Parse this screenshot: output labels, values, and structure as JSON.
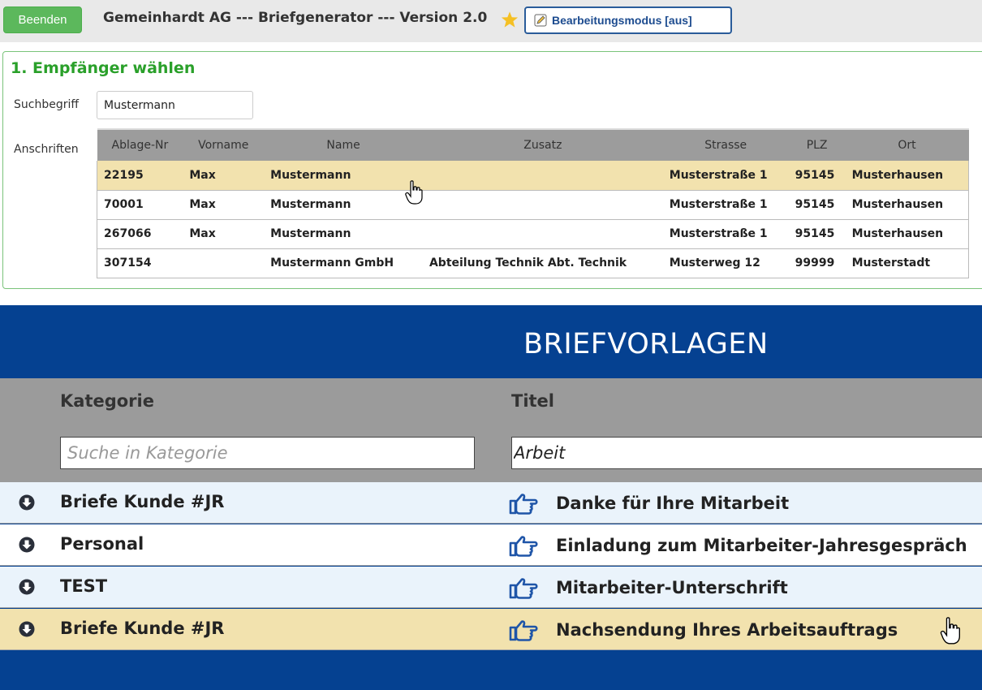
{
  "toolbar": {
    "quit_label": "Beenden",
    "app_title": "Gemeinhardt AG --- Briefgenerator --- Version 2.0",
    "edit_mode_label": "Bearbeitungsmodus [aus]",
    "star_color": "#f5c024"
  },
  "recipient": {
    "section_title": "1. Empfänger wählen",
    "search_label": "Suchbegriff",
    "search_value": "Mustermann",
    "addresses_label": "Anschriften",
    "columns": [
      "Ablage-Nr",
      "Vorname",
      "Name",
      "Zusatz",
      "Strasse",
      "PLZ",
      "Ort"
    ],
    "rows": [
      {
        "ablage": "22195",
        "vorname": "Max",
        "name": "Mustermann",
        "zusatz": "",
        "strasse": "Musterstraße 1",
        "plz": "95145",
        "ort": "Musterhausen"
      },
      {
        "ablage": "70001",
        "vorname": "Max",
        "name": "Mustermann",
        "zusatz": "",
        "strasse": "Musterstraße 1",
        "plz": "95145",
        "ort": "Musterhausen"
      },
      {
        "ablage": "267066",
        "vorname": "Max",
        "name": "Mustermann",
        "zusatz": "",
        "strasse": "Musterstraße 1",
        "plz": "95145",
        "ort": "Musterhausen"
      },
      {
        "ablage": "307154",
        "vorname": "",
        "name": "Mustermann GmbH",
        "zusatz": "Abteilung Technik Abt. Technik",
        "strasse": "Musterweg 12",
        "plz": "99999",
        "ort": "Musterstadt"
      }
    ]
  },
  "templates": {
    "title": "BRIEFVORLAGEN",
    "col_category": "Kategorie",
    "col_title": "Titel",
    "category_placeholder": "Suche in Kategorie",
    "title_filter_value": "Arbeit",
    "rows": [
      {
        "category": "Briefe Kunde #JR",
        "title": "Danke für Ihre Mitarbeit"
      },
      {
        "category": "Personal",
        "title": "Einladung zum Mitarbeiter-Jahresgespräch"
      },
      {
        "category": "TEST",
        "title": "Mitarbeiter-Unterschrift"
      },
      {
        "category": "Briefe Kunde #JR",
        "title": "Nachsendung Ihres Arbeitsauftrags"
      }
    ]
  },
  "colors": {
    "accent_green": "#2aa02a",
    "header_blue": "#054191",
    "highlight_row": "#f2e2ae"
  }
}
